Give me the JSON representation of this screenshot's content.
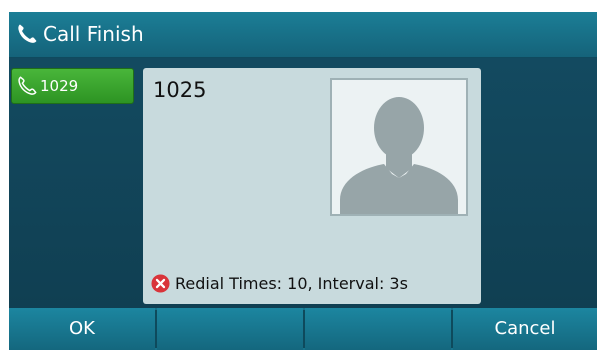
{
  "title_bar": {
    "title": "Call Finish",
    "icon": "phone-icon"
  },
  "line_key": {
    "label": "1029",
    "icon": "phone-icon",
    "color": "#3fa82f"
  },
  "call_card": {
    "number": "1025",
    "avatar_icon": "contact-silhouette-icon",
    "status": {
      "icon": "error-x-icon",
      "text": "Redial Times: 10, Interval: 3s",
      "icon_color": "#d9343a"
    }
  },
  "softkeys": [
    {
      "label": "OK"
    },
    {
      "label": ""
    },
    {
      "label": ""
    },
    {
      "label": "Cancel"
    }
  ]
}
